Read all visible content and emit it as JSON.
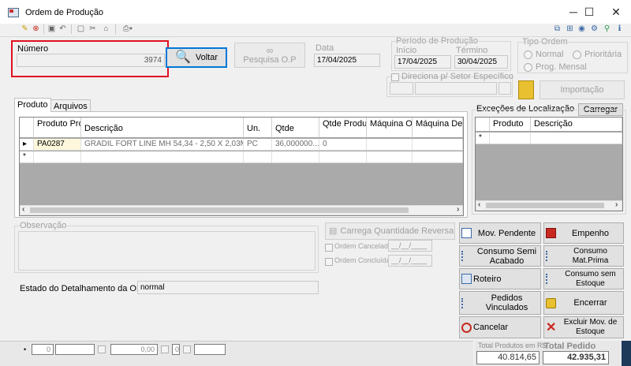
{
  "window": {
    "title": "Ordem de Produção",
    "minimize": "─",
    "maximize": "☐",
    "close": "✕"
  },
  "numero": {
    "label": "Número",
    "value": "3974"
  },
  "voltar_label": "Voltar",
  "pesquisa_label": "Pesquisa O.P",
  "data": {
    "label": "Data",
    "value": "17/04/2025"
  },
  "periodo": {
    "label": "Período de Produção",
    "inicio_label": "Início",
    "inicio": "17/04/2025",
    "termino_label": "Término",
    "termino": "30/04/2025"
  },
  "tipo_ordem": {
    "label": "Tipo Ordem",
    "normal": "Normal",
    "prioritaria": "Prioritária",
    "prog_mensal": "Prog. Mensal"
  },
  "direciona_label": "Direciona p/ Setor Específico",
  "importacao_label": "Importação",
  "tabs": [
    "Produto",
    "Arquivos"
  ],
  "produtos_grid": {
    "headers": [
      "Produto Produção",
      "Descrição",
      "Un.",
      "Qtde",
      "Qtde Produzida",
      "Máquina Op.",
      "Máquina Descr."
    ],
    "row": [
      "PA0287",
      "GRADIL FORT LINE MH 54,34 - 2,50 X 2,03M...",
      "PC",
      "36,000000...",
      "0",
      "",
      ""
    ],
    "row_marker": "▸",
    "new_marker": "*"
  },
  "excecoes": {
    "label": "Exceções de Localização",
    "carregar": "Carregar",
    "headers": [
      "Produto",
      "Descrição"
    ],
    "new_marker": "*"
  },
  "observacao_label": "Observação",
  "carrega_label": "Carrega Quantidade Reversa",
  "ordem_cancelada": {
    "label": "Ordem Cancelada",
    "value": "__/__/____"
  },
  "ordem_concluida": {
    "label": "Ordem Concluída",
    "value": "__/__/____"
  },
  "estado": {
    "label": "Estado do Detalhamento da OP:",
    "value": "normal"
  },
  "actions": [
    {
      "name": "mov-pendente",
      "label": "Mov. Pendente",
      "color": "#3a6aa8"
    },
    {
      "name": "empenho",
      "label": "Empenho",
      "color": "#c8281e"
    },
    {
      "name": "consumo-semi-acabado",
      "label": "Consumo Semi Acabado",
      "color": "#3a6aa8"
    },
    {
      "name": "consumo-mat-prima",
      "label": "Consumo Mat.Prima",
      "color": "#3a6aa8"
    },
    {
      "name": "roteiro",
      "label": "Roteiro",
      "color": "#3a6aa8"
    },
    {
      "name": "consumo-sem-estoque",
      "label": "Consumo sem Estoque",
      "color": "#3a6aa8"
    },
    {
      "name": "pedidos-vinculados",
      "label": "Pedidos Vinculados",
      "color": "#3a6aa8"
    },
    {
      "name": "encerrar",
      "label": "Encerrar",
      "color": "#d9a400"
    },
    {
      "name": "cancelar",
      "label": "Cancelar",
      "color": "#c8281e"
    },
    {
      "name": "excluir-mov-estoque",
      "label": "Excluir Mov. de Estoque",
      "color": "#c8281e"
    }
  ],
  "background": {
    "row_values": [
      "0",
      "0,00"
    ],
    "total_produtos_label": "Total Produtos em R$",
    "total_produtos": "40.814,65",
    "total_pedido_label": "Total Pedido",
    "total_pedido": "42.935,31"
  },
  "colors": {
    "highlight_border": "#e01020",
    "accent": "#0078d7"
  }
}
